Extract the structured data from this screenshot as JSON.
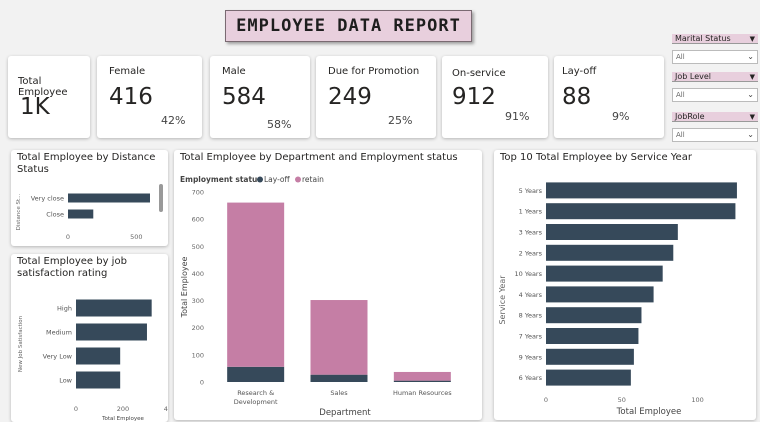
{
  "report": {
    "title": "EMPLOYEE DATA REPORT"
  },
  "kpis": [
    {
      "label": "Total Employee",
      "value": "1K",
      "pct": ""
    },
    {
      "label": "Female",
      "value": "416",
      "pct": "42%"
    },
    {
      "label": "Male",
      "value": "584",
      "pct": "58%"
    },
    {
      "label": "Due for Promotion",
      "value": "249",
      "pct": "25%"
    },
    {
      "label": "On-service",
      "value": "912",
      "pct": "91%"
    },
    {
      "label": "Lay-off",
      "value": "88",
      "pct": "9%"
    }
  ],
  "slicers": [
    {
      "label": "Marital Status",
      "value": "All"
    },
    {
      "label": "Job Level",
      "value": "All"
    },
    {
      "label": "JobRole",
      "value": "All"
    }
  ],
  "colors": {
    "dark": "#36495a",
    "pink": "#c57ea5",
    "header_pink": "#e8cfdd"
  },
  "chart_data": [
    {
      "type": "bar",
      "orientation": "horizontal",
      "title": "Total Employee by Distance Status",
      "ylabel": "Distance St...",
      "xlabel": "",
      "categories": [
        "Very close",
        "Close"
      ],
      "values": [
        600,
        185
      ],
      "xlim": [
        0,
        600
      ],
      "xticks": [
        "0",
        "500"
      ],
      "tick_values": [
        0,
        500
      ]
    },
    {
      "type": "bar",
      "orientation": "horizontal",
      "title": "Total Employee by job satisfaction rating",
      "ylabel": "New Job Satisfaction",
      "xlabel": "Total Employee",
      "categories": [
        "High",
        "Medium",
        "Very Low",
        "Low"
      ],
      "values": [
        322,
        302,
        188,
        188
      ],
      "xlim": [
        0,
        400
      ],
      "xticks": [
        "0",
        "200",
        "400"
      ],
      "tick_values": [
        0,
        200,
        400
      ]
    },
    {
      "type": "bar",
      "stacked": true,
      "title": "Total Employee by Department and Employment status",
      "legend_title": "Employment status",
      "xlabel": "Department",
      "ylabel": "Total Employee",
      "categories": [
        "Research & Development",
        "Sales",
        "Human Resources"
      ],
      "series": [
        {
          "name": "Lay-off",
          "values": [
            56,
            27,
            5
          ]
        },
        {
          "name": "retain",
          "values": [
            605,
            275,
            32
          ]
        }
      ],
      "ylim": [
        0,
        700
      ],
      "yticks": [
        "0",
        "100",
        "200",
        "300",
        "400",
        "500",
        "600",
        "700"
      ],
      "tick_values": [
        0,
        100,
        200,
        300,
        400,
        500,
        600,
        700
      ]
    },
    {
      "type": "bar",
      "orientation": "horizontal",
      "title": "Top 10 Total Employee by Service Year",
      "ylabel": "Service Year",
      "xlabel": "Total Employee",
      "categories": [
        "5 Years",
        "1 Years",
        "3 Years",
        "2 Years",
        "10 Years",
        "4 Years",
        "8 Years",
        "7 Years",
        "9 Years",
        "6 Years"
      ],
      "values": [
        126,
        125,
        87,
        84,
        77,
        71,
        63,
        61,
        58,
        56
      ],
      "xlim": [
        0,
        130
      ],
      "xticks": [
        "0",
        "50",
        "100"
      ],
      "tick_values": [
        0,
        50,
        100
      ]
    }
  ]
}
